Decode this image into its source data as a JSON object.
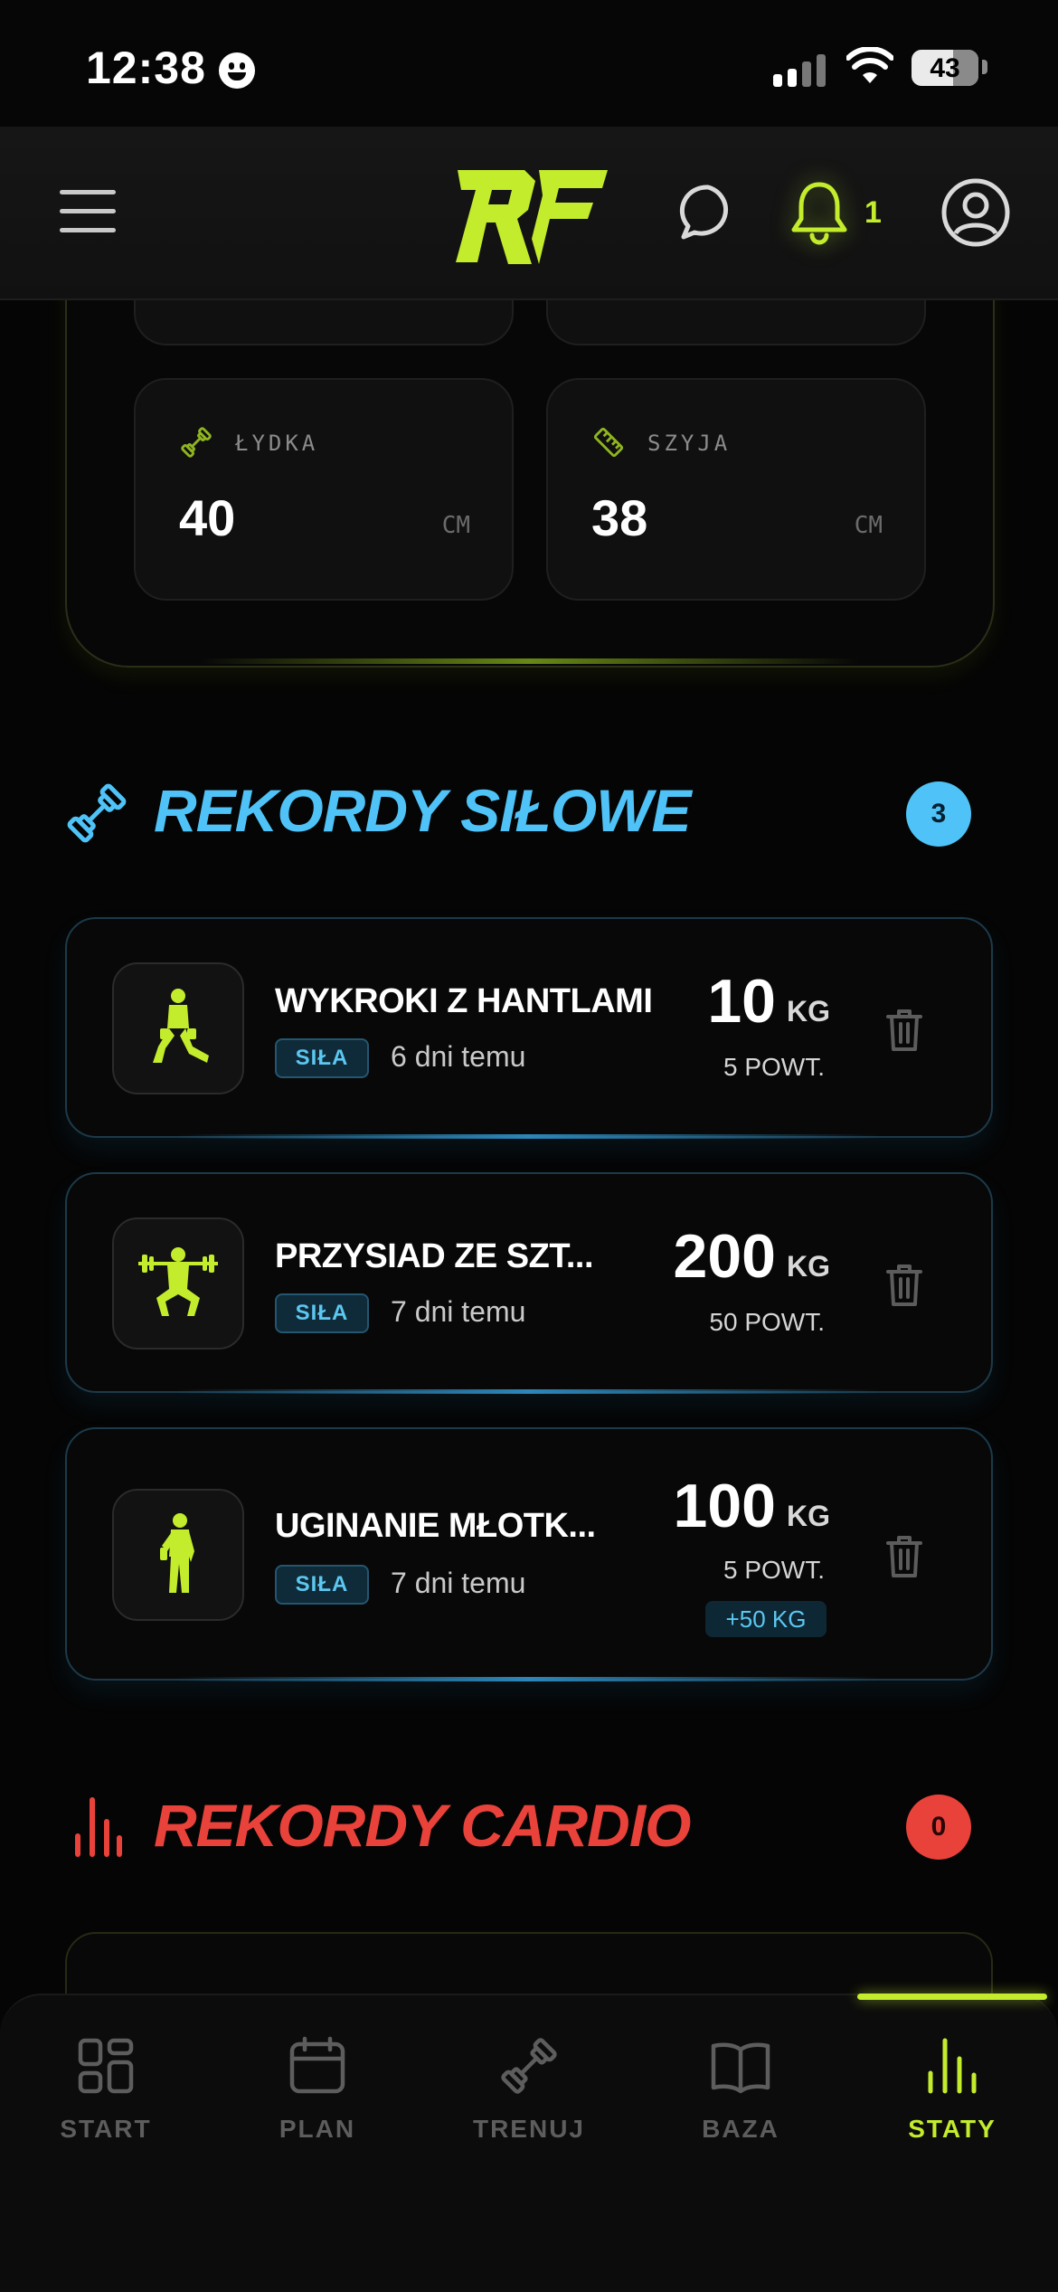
{
  "status_bar": {
    "time": "12:38",
    "battery": "43"
  },
  "header": {
    "logo_text": "RF",
    "notification_count": "1"
  },
  "measurements": [
    {
      "label": "ŁYDKA",
      "value": "40",
      "unit": "CM",
      "icon": "dumbbell-icon"
    },
    {
      "label": "SZYJA",
      "value": "38",
      "unit": "CM",
      "icon": "ruler-icon"
    }
  ],
  "strength_section": {
    "title": "REKORDY SIŁOWE",
    "count": "3",
    "color": "#4fc3f7",
    "records": [
      {
        "name": "WYKROKI Z HANTLAMI",
        "tag": "SIŁA",
        "time": "6 dni temu",
        "value": "10",
        "unit": "KG",
        "reps": "5 POWT.",
        "delta": null
      },
      {
        "name": "PRZYSIAD ZE SZT...",
        "tag": "SIŁA",
        "time": "7 dni temu",
        "value": "200",
        "unit": "KG",
        "reps": "50 POWT.",
        "delta": null
      },
      {
        "name": "UGINANIE MŁOTK...",
        "tag": "SIŁA",
        "time": "7 dni temu",
        "value": "100",
        "unit": "KG",
        "reps": "5 POWT.",
        "delta": "+50 KG"
      }
    ]
  },
  "cardio_section": {
    "title": "REKORDY CARDIO",
    "count": "0",
    "color": "#e8423a"
  },
  "bottom_nav": {
    "active": "STATY",
    "accent": "#c3ec2c",
    "items": [
      {
        "label": "START",
        "icon": "grid-icon"
      },
      {
        "label": "PLAN",
        "icon": "calendar-icon"
      },
      {
        "label": "TRENUJ",
        "icon": "dumbbell-icon"
      },
      {
        "label": "BAZA",
        "icon": "book-icon"
      },
      {
        "label": "STATY",
        "icon": "bar-chart-icon"
      }
    ]
  }
}
